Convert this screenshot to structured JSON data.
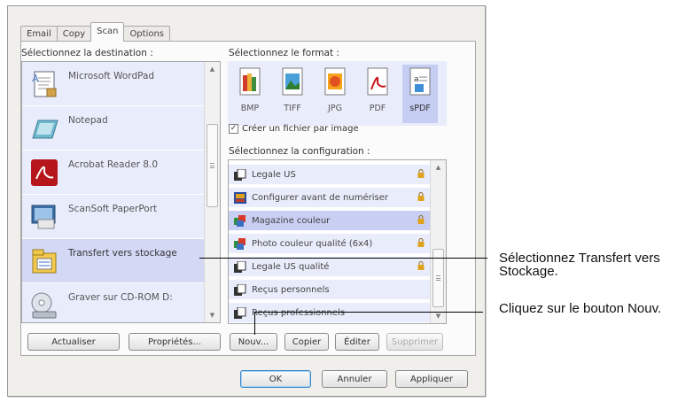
{
  "tabs": [
    {
      "label": "Email"
    },
    {
      "label": "Copy"
    },
    {
      "label": "Scan",
      "active": true
    },
    {
      "label": "Options"
    }
  ],
  "destination": {
    "heading": "Sélectionnez la destination :",
    "items": [
      {
        "label": "Microsoft WordPad",
        "icon": "wordpad-icon"
      },
      {
        "label": "Notepad",
        "icon": "notepad-icon"
      },
      {
        "label": "Acrobat Reader 8.0",
        "icon": "acrobat-icon"
      },
      {
        "label": "ScanSoft PaperPort",
        "icon": "paperport-icon"
      },
      {
        "label": "Transfert vers stockage",
        "icon": "storage-transfer-icon",
        "selected": true
      },
      {
        "label": "Graver sur CD-ROM  D:",
        "icon": "cd-burner-icon"
      }
    ],
    "refresh_label": "Actualiser",
    "properties_label": "Propriétés..."
  },
  "format": {
    "heading": "Sélectionnez le format :",
    "items": [
      {
        "label": "BMP",
        "icon": "bmp-file-icon"
      },
      {
        "label": "TIFF",
        "icon": "tiff-file-icon"
      },
      {
        "label": "JPG",
        "icon": "jpg-file-icon"
      },
      {
        "label": "PDF",
        "icon": "pdf-file-icon"
      },
      {
        "label": "sPDF",
        "icon": "spdf-file-icon",
        "selected": true
      }
    ],
    "checkbox_label": "Créer un fichier par image",
    "checkbox_checked": true
  },
  "configuration": {
    "heading": "Sélectionnez la configuration :",
    "items": [
      {
        "label": "Legale US",
        "icon": "bw-page-icon",
        "locked": true
      },
      {
        "label": "Configurer avant de numériser",
        "icon": "configure-icon",
        "locked": true
      },
      {
        "label": "Magazine couleur",
        "icon": "color-page-icon",
        "locked": true,
        "selected": true
      },
      {
        "label": "Photo couleur qualité (6x4)",
        "icon": "color-page-icon",
        "locked": true
      },
      {
        "label": "Legale US qualité",
        "icon": "bw-page-icon",
        "locked": true
      },
      {
        "label": "Reçus personnels",
        "icon": "bw-page-icon",
        "locked": false
      },
      {
        "label": "Reçus professionnels",
        "icon": "bw-page-icon",
        "locked": false
      }
    ],
    "new_label": "Nouv...",
    "copy_label": "Copier",
    "edit_label": "Éditer",
    "delete_label": "Supprimer"
  },
  "dialog": {
    "ok_label": "OK",
    "cancel_label": "Annuler",
    "apply_label": "Appliquer"
  },
  "callouts": {
    "destination": "Sélectionnez Transfert vers Stockage.",
    "new_button": "Cliquez sur le bouton Nouv."
  },
  "colors": {
    "selection": "#d3d8f5",
    "list_bg": "#e9ecfb",
    "lock": "#e0a11b"
  }
}
